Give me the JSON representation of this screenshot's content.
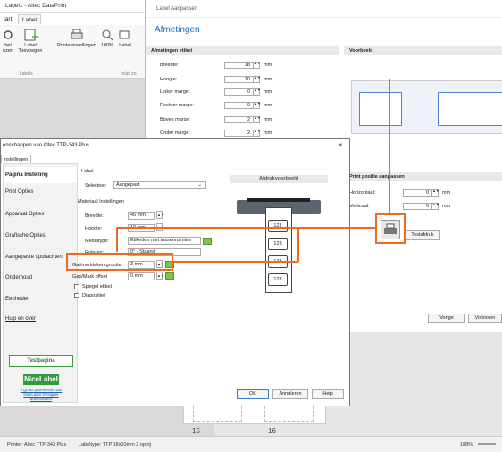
{
  "app": {
    "title": "Label1 - Altec DataPrint",
    "tabs": [
      "tart",
      "Label"
    ],
    "ribbon": {
      "items": [
        "bel\nezen",
        "Label\nToevoegen",
        "Printerinstellingen",
        "100%",
        "Label"
      ],
      "group_labels": [
        "Labels",
        "In/uit zo"
      ]
    },
    "page_numbers": [
      "15",
      "16"
    ],
    "status": {
      "printer": "Printer:  Altec TTP-343 Plus",
      "labeltype": "Labeltype:  TTP 18x10mm 2 op rij",
      "zoom": "188%"
    }
  },
  "wizard": {
    "title": "Label Aanpassen",
    "heading": "Afmetingen",
    "dims_header": "Afmetingen etiket",
    "preview_header": "Voorbeeld",
    "fields": [
      {
        "label": "Breedte:",
        "value": "18",
        "unit": "mm"
      },
      {
        "label": "Hoogte:",
        "value": "10",
        "unit": "mm"
      },
      {
        "label": "Linker marge:",
        "value": "0",
        "unit": "mm"
      },
      {
        "label": "Rechter marge:",
        "value": "0",
        "unit": "mm"
      },
      {
        "label": "Boven marge:",
        "value": "2",
        "unit": "mm"
      },
      {
        "label": "Onder marge:",
        "value": "2",
        "unit": "mm"
      }
    ],
    "print_pos_header": "Print positie aanpassen",
    "horizontal": {
      "label": "Horizontaal:",
      "value": "0",
      "unit": "mm"
    },
    "vertical": {
      "label": "Verticaal:",
      "value": "0",
      "unit": "mm"
    },
    "testprint": "Testafdruk",
    "prev": "Vorige",
    "finish": "Voltooien"
  },
  "props": {
    "title": "enschappen van Altec TTP-343 Plus",
    "close": "×",
    "tab": "nstellingen",
    "nav": [
      "Pagina Instelling",
      "Print Opties",
      "Apparaat Opties",
      "Grafische Opties",
      "Aangepaste opdrachten",
      "Onderhoud",
      "Eenheden",
      "Hulp en over"
    ],
    "testpage": "Testpagina",
    "nicelabel": "NiceLabel",
    "nicelabel_link": "e gratis proefversie van\nNiceLabel Designer\ndownloaden",
    "label_group": "Label",
    "select_label": "Selecteer:",
    "select_value": "Aangepast",
    "material_header": "Materiaal Instellingen",
    "preview_header": "Afdrukvoorbeeld",
    "rows": [
      {
        "label": "Breedte:",
        "value": "45 mm"
      },
      {
        "label": "Hoogte:",
        "value": "10 mm"
      },
      {
        "label": "Mediatype:",
        "value": "Etiketten met tussenruimtes"
      },
      {
        "label": "Roteren:",
        "value": "0° - Staand"
      },
      {
        "label": "Gat/merkteken grootte:",
        "value": "3 mm"
      },
      {
        "label": "Gap/Mark offset",
        "value": "0 mm"
      }
    ],
    "checkbox1": "Spiegel etiket",
    "checkbox2": "Diapositief",
    "preview_label_text": "123",
    "ok": "OK",
    "cancel": "Annuleren",
    "help": "Help"
  },
  "colors": {
    "highlight": "#ee6a23",
    "accent": "#1a6bbf",
    "green": "#74c74c"
  }
}
